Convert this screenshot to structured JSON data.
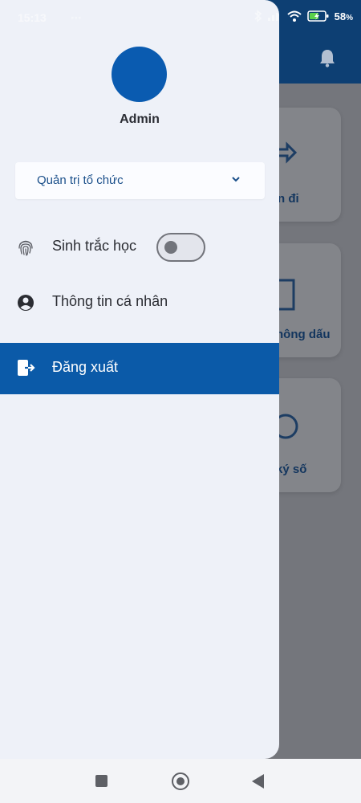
{
  "status_bar": {
    "time": "15:13",
    "battery_percent": "58",
    "battery_unit": "%"
  },
  "background": {
    "cards": [
      {
        "label": "n đi",
        "icon": "transfer-icon"
      },
      {
        "label": "hông dấu",
        "icon": "stamp-icon"
      },
      {
        "label": "ký số",
        "icon": "sign-icon"
      }
    ]
  },
  "drawer": {
    "user_name": "Admin",
    "org_select": {
      "value": "Quản trị tổ chức"
    },
    "menu": {
      "biometrics": "Sinh trắc học",
      "biometrics_enabled": false,
      "profile": "Thông tin cá nhân",
      "logout": "Đăng xuất"
    }
  },
  "colors": {
    "accent": "#0b5aa8",
    "header": "#0d3f73",
    "drawer_bg": "#eef1f8"
  }
}
